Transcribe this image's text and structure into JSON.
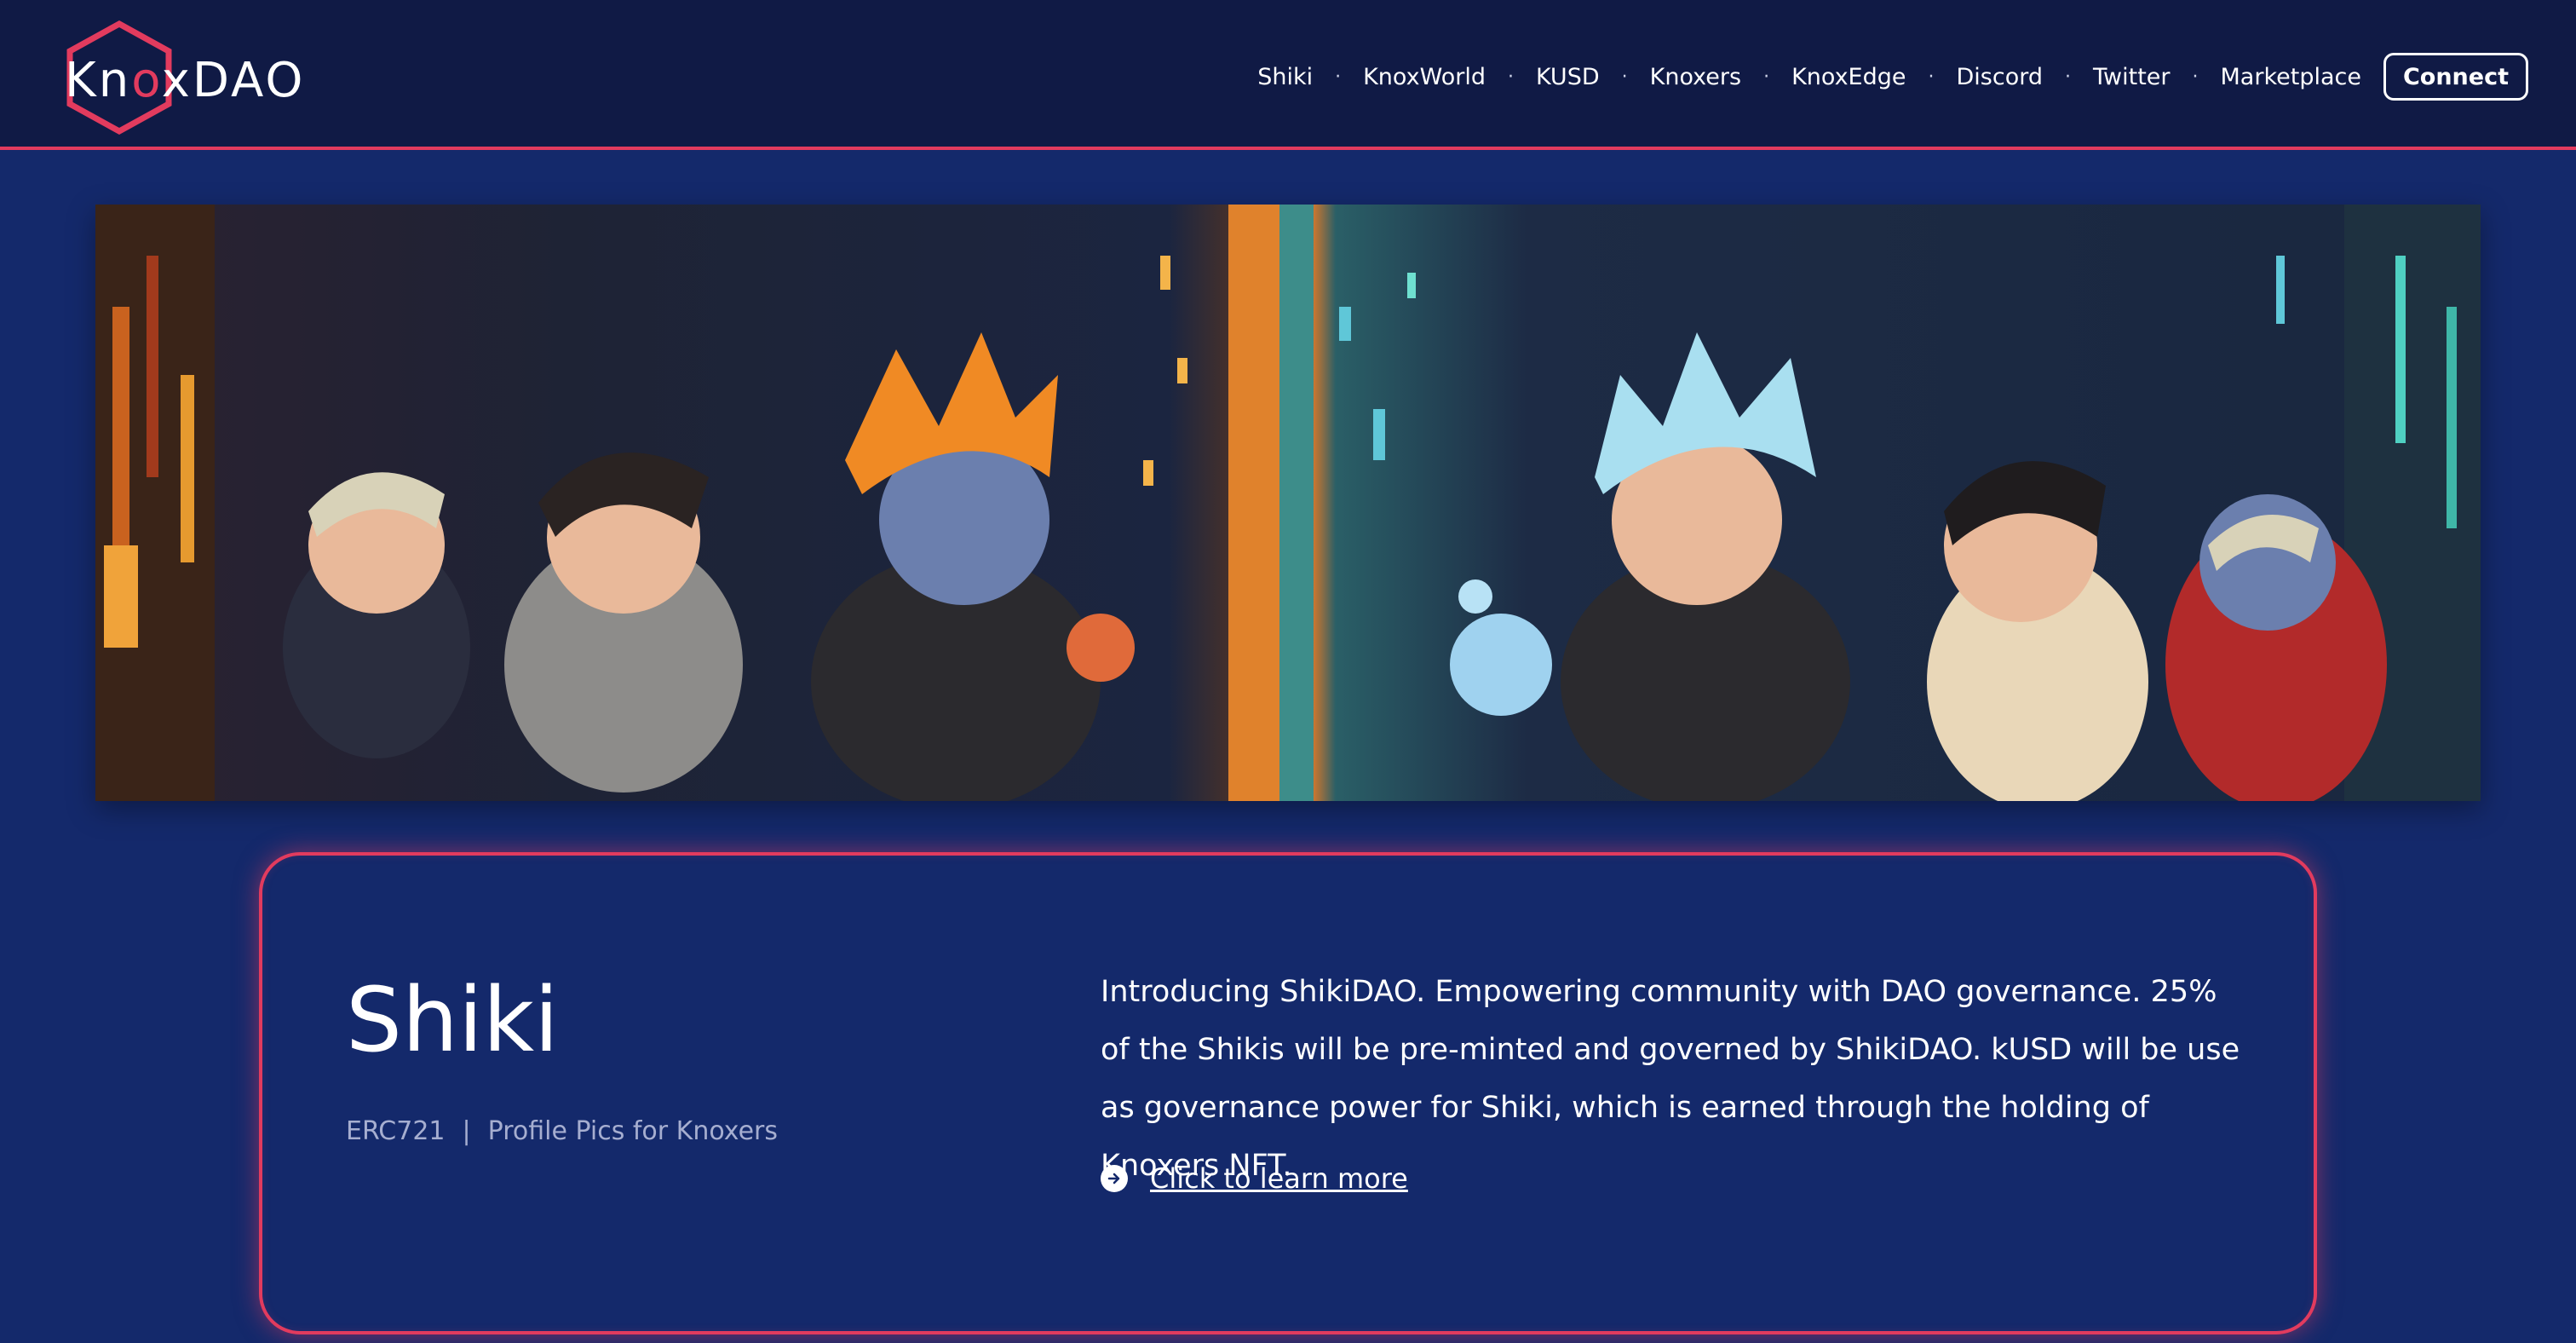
{
  "brand": {
    "logo_part1": "Kn",
    "logo_o": "o",
    "logo_part2": "xDAO",
    "accent_color": "#e23b5e"
  },
  "nav": {
    "items": [
      {
        "label": "Shiki"
      },
      {
        "label": "KnoxWorld"
      },
      {
        "label": "KUSD"
      },
      {
        "label": "Knoxers"
      },
      {
        "label": "KnoxEdge"
      },
      {
        "label": "Discord"
      },
      {
        "label": "Twitter"
      },
      {
        "label": "Marketplace"
      }
    ],
    "separator": "·",
    "connect_label": "Connect"
  },
  "banner": {
    "icon": "pixel-art-characters-banner"
  },
  "card": {
    "title": "Shiki",
    "standard": "ERC721",
    "meta_separator": "|",
    "subtitle": "Profile Pics for Knoxers",
    "description": "Introducing ShikiDAO. Empowering community with DAO governance. 25% of the Shikis will be pre-minted and governed by ShikiDAO. kUSD will be use as governance power for Shiki, which is earned through the holding of Knoxers NFT.",
    "learn_more_label": "Click to learn more",
    "learn_more_icon": "arrow-circle-right-icon"
  }
}
